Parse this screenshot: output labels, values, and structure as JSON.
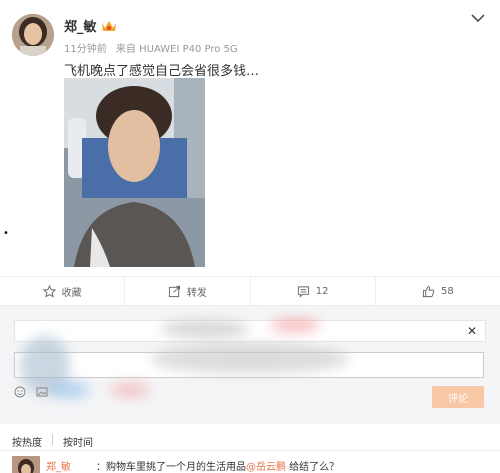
{
  "post": {
    "user_name": "郑_敏",
    "time": "11分钟前",
    "source": "来自 HUAWEI P40 Pro 5G",
    "text": "飞机晚点了感觉自己会省很多钱…"
  },
  "side_mark": "•",
  "actions": [
    {
      "label": "收藏",
      "icon": "star-icon"
    },
    {
      "label": "转发",
      "icon": "share-icon"
    },
    {
      "label": "12",
      "icon": "comment-icon"
    },
    {
      "label": "58",
      "icon": "thumbs-up-icon"
    }
  ],
  "comment_box": {
    "notice_close": "✕",
    "submit_label": "评论"
  },
  "sort": {
    "hot": "按热度",
    "time": "按时间"
  },
  "comment": {
    "name": "郑_敏",
    "prefix": "：购物车里挑了一个月的生活用品",
    "mention": "@岳云鹏",
    "suffix": " 给结了么？"
  },
  "colors": {
    "accent": "#eb7350",
    "submit_bg": "#f8c7a5",
    "comment_bg": "#f4f5f7"
  }
}
